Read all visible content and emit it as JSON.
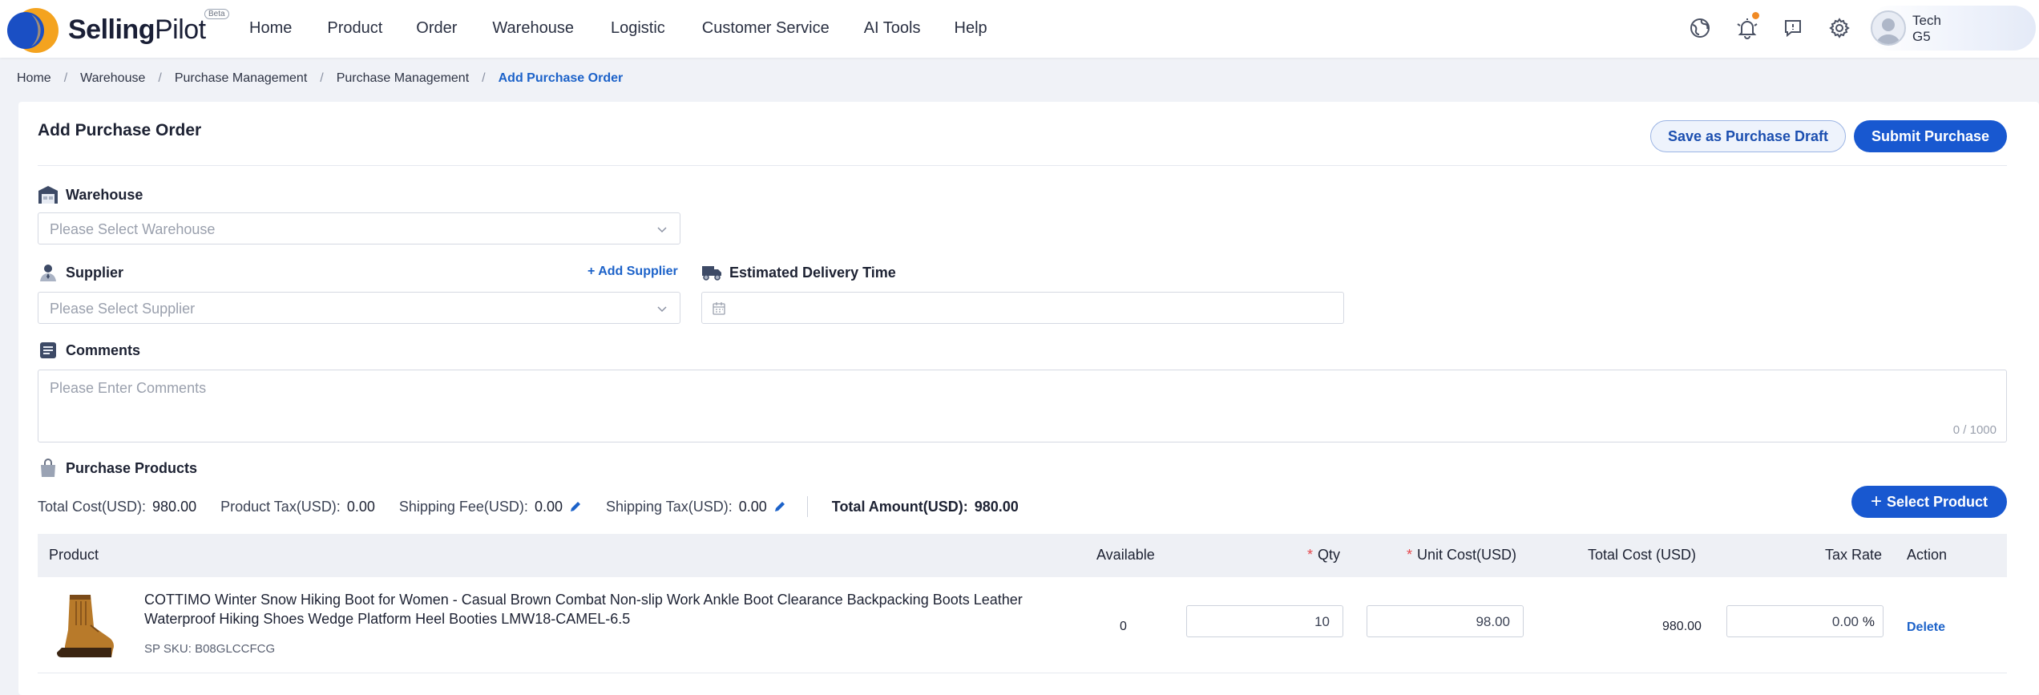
{
  "brand": {
    "name_bold": "Selling",
    "name_light": "Pilot",
    "badge": "Beta"
  },
  "nav": {
    "items": [
      "Home",
      "Product",
      "Order",
      "Warehouse",
      "Logistic",
      "Customer Service",
      "AI Tools",
      "Help"
    ]
  },
  "header_icons": [
    "globe-icon",
    "bell-icon",
    "feedback-icon",
    "gear-icon"
  ],
  "user": {
    "line1": "Tech",
    "line2": "G5"
  },
  "breadcrumb": [
    "Home",
    "Warehouse",
    "Purchase Management",
    "Purchase Management",
    "Add Purchase Order"
  ],
  "page": {
    "title": "Add Purchase Order",
    "draft_button": "Save as Purchase Draft",
    "submit_button": "Submit Purchase"
  },
  "form": {
    "warehouse_label": "Warehouse",
    "warehouse_placeholder": "Please Select Warehouse",
    "supplier_label": "Supplier",
    "add_supplier": "+ Add Supplier",
    "supplier_placeholder": "Please Select Supplier",
    "delivery_label": "Estimated Delivery Time",
    "comments_label": "Comments",
    "comments_placeholder": "Please Enter Comments",
    "comments_counter": "0 / 1000"
  },
  "products": {
    "label": "Purchase Products",
    "totals": {
      "total_cost_label": "Total Cost(USD):",
      "total_cost": "980.00",
      "product_tax_label": "Product Tax(USD):",
      "product_tax": "0.00",
      "shipping_fee_label": "Shipping Fee(USD):",
      "shipping_fee": "0.00",
      "shipping_tax_label": "Shipping Tax(USD):",
      "shipping_tax": "0.00",
      "total_amount_label": "Total Amount(USD):",
      "total_amount": "980.00"
    },
    "select_button": "Select Product",
    "columns": {
      "product": "Product",
      "available": "Available",
      "qty": "Qty",
      "unit_cost": "Unit Cost(USD)",
      "total_cost": "Total Cost (USD)",
      "tax_rate": "Tax Rate",
      "action": "Action"
    },
    "rows": [
      {
        "title": "COTTIMO Winter Snow Hiking Boot for Women - Casual Brown Combat Non-slip Work Ankle Boot Clearance Backpacking Boots Leather Waterproof Hiking Shoes Wedge Platform Heel Booties LMW18-CAMEL-6.5",
        "sku": "SP SKU: B08GLCCFCG",
        "available": "0",
        "qty": "10",
        "unit_cost": "98.00",
        "total_cost": "980.00",
        "tax_rate": "0.00",
        "tax_suffix": "%",
        "action": "Delete"
      }
    ]
  },
  "colors": {
    "primary": "#1858d0",
    "accent": "#1c62c9",
    "notification": "#f08a24"
  }
}
